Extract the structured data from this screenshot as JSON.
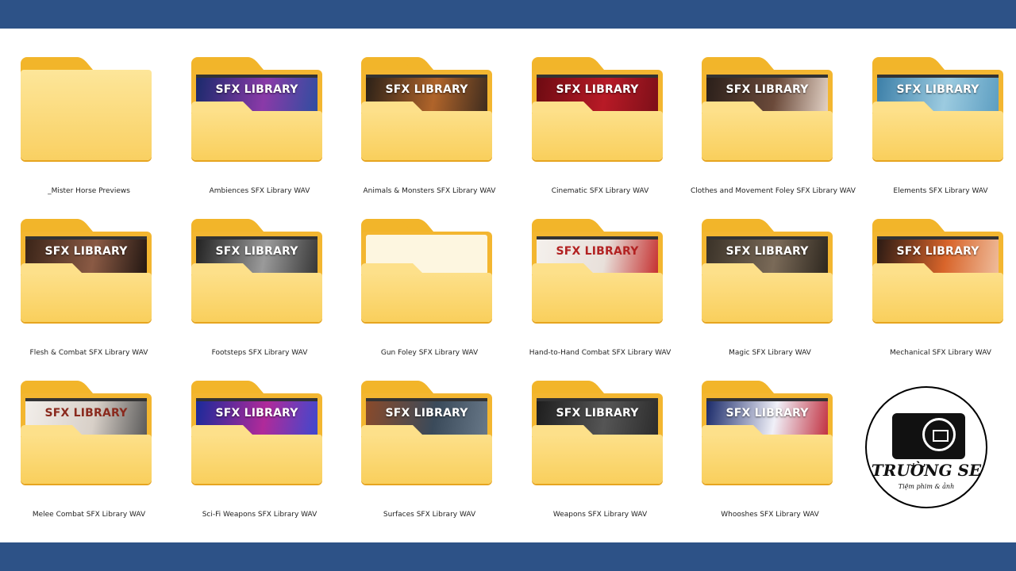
{
  "folders": [
    {
      "name": "_Mister Horse Previews",
      "thumbnail": null
    },
    {
      "name": "Ambiences SFX Library WAV",
      "thumbnail": {
        "label": "SFX LIBRARY",
        "colors": [
          "#1a2a6c",
          "#8a3aa8",
          "#2b4fa0"
        ]
      }
    },
    {
      "name": "Animals & Monsters SFX Library WAV",
      "thumbnail": {
        "label": "SFX LIBRARY",
        "colors": [
          "#2b2118",
          "#b0642a",
          "#3a2a1e"
        ]
      }
    },
    {
      "name": "Cinematic SFX Library WAV",
      "thumbnail": {
        "label": "SFX LIBRARY",
        "colors": [
          "#6d0b12",
          "#b81a26",
          "#7a0f18"
        ]
      }
    },
    {
      "name": "Clothes and Movement Foley SFX Library WAV",
      "thumbnail": {
        "label": "SFX LIBRARY",
        "colors": [
          "#2a1f1a",
          "#6b4a3a",
          "#e8d8cc"
        ]
      }
    },
    {
      "name": "Elements SFX Library WAV",
      "thumbnail": {
        "label": "SFX LIBRARY",
        "colors": [
          "#3c7fa8",
          "#9ccbe0",
          "#5a9cc0"
        ]
      }
    },
    {
      "name": "Flesh & Combat SFX Library WAV",
      "thumbnail": {
        "label": "SFX LIBRARY",
        "colors": [
          "#3a2418",
          "#8a5a44",
          "#1e1410"
        ]
      }
    },
    {
      "name": "Footsteps SFX Library WAV",
      "thumbnail": {
        "label": "SFX LIBRARY",
        "colors": [
          "#222222",
          "#9a9a9a",
          "#333333"
        ]
      }
    },
    {
      "name": "Gun Foley SFX Library WAV",
      "thumbnail": null
    },
    {
      "name": "Hand-to-Hand Combat SFX Library WAV",
      "thumbnail": {
        "label": "SFX LIBRARY",
        "colors": [
          "#f4f0ec",
          "#e8e0da",
          "#c42a2a"
        ],
        "label_color": "#b22222"
      }
    },
    {
      "name": "Magic SFX Library WAV",
      "thumbnail": {
        "label": "SFX LIBRARY",
        "colors": [
          "#3a3228",
          "#7a6a58",
          "#2a241c"
        ]
      }
    },
    {
      "name": "Mechanical SFX Library WAV",
      "thumbnail": {
        "label": "SFX LIBRARY",
        "colors": [
          "#2a1a14",
          "#d8642a",
          "#f0c0a0"
        ]
      }
    },
    {
      "name": "Melee Combat SFX Library WAV",
      "thumbnail": {
        "label": "SFX LIBRARY",
        "colors": [
          "#f2eeea",
          "#d8d0c8",
          "#555555"
        ],
        "label_color": "#8a2a1e"
      }
    },
    {
      "name": "Sci-Fi Weapons SFX Library WAV",
      "thumbnail": {
        "label": "SFX LIBRARY",
        "colors": [
          "#1a2a9a",
          "#b02a9a",
          "#3a4ad0"
        ]
      }
    },
    {
      "name": "Surfaces SFX Library WAV",
      "thumbnail": {
        "label": "SFX LIBRARY",
        "colors": [
          "#8a4a2a",
          "#3a4a5a",
          "#6a7a8a"
        ]
      }
    },
    {
      "name": "Weapons SFX Library WAV",
      "thumbnail": {
        "label": "SFX LIBRARY",
        "colors": [
          "#1e1e1e",
          "#555555",
          "#2a2a2a"
        ]
      }
    },
    {
      "name": "Whooshes SFX Library WAV",
      "thumbnail": {
        "label": "SFX LIBRARY",
        "colors": [
          "#1a2a6a",
          "#f0f0f8",
          "#c02a3a"
        ]
      }
    }
  ],
  "logo": {
    "brand": "TRƯỜNG SE",
    "tagline": "Tiệm phim & ảnh"
  },
  "colors": {
    "header_bar": "#2d5287",
    "folder": "#f3b630"
  }
}
